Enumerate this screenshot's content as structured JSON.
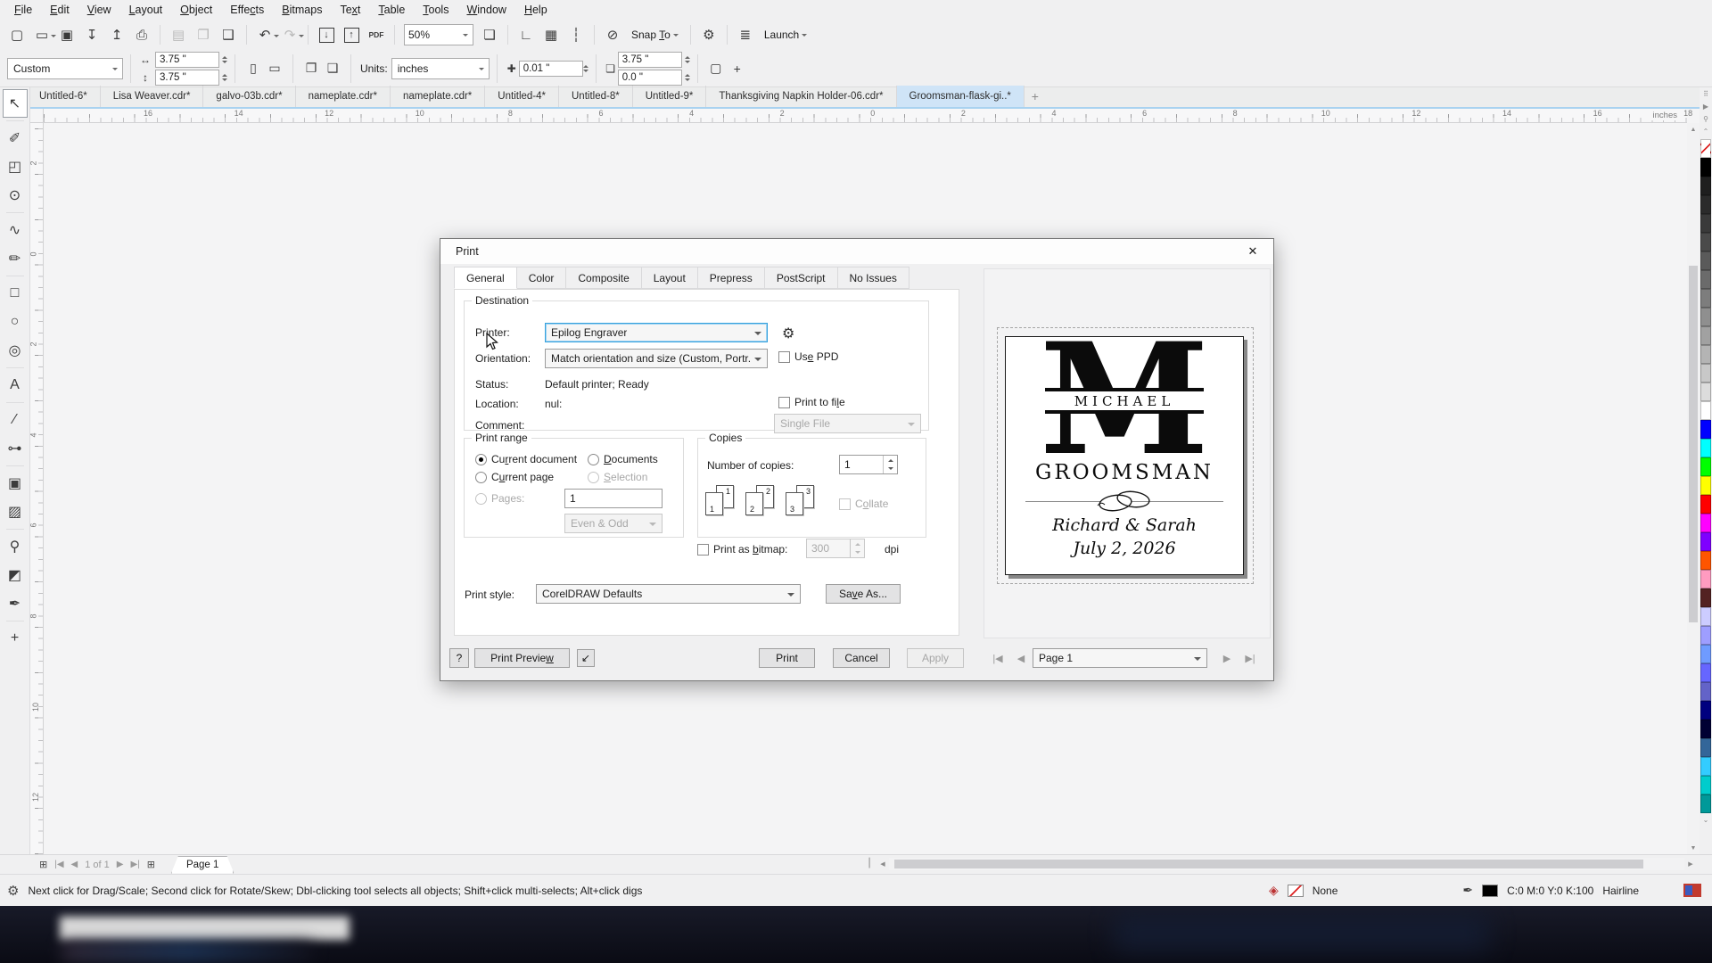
{
  "icons": {
    "close": "✕",
    "home": "⌂",
    "gear": "⚙",
    "plus": "+",
    "minimize": "↙",
    "first": "|◀",
    "prev": "◀",
    "next": "▶",
    "last": "▶|",
    "plus_page": "⊞",
    "scroll_left": "◀",
    "scroll_right": "▶",
    "scroll_up": "▲",
    "scroll_down": "▼",
    "dots": "⠿",
    "play": "▶",
    "dropper": "⚲",
    "chev_up": "⌃",
    "chev_down": "⌄",
    "fill_diamond": "◈",
    "pen_nib": "✒",
    "width_arrow": "↔",
    "height_arrow": "↕",
    "portrait": "▯",
    "landscape": "▭",
    "all_pages": "❐",
    "current_page": "❑",
    "nudge": "✚",
    "dup_distance": "❏",
    "treat_filled": "▢",
    "splitter": "┃"
  },
  "menu_bar": {
    "items": [
      {
        "label": "File",
        "key": 0
      },
      {
        "label": "Edit",
        "key": 0
      },
      {
        "label": "View",
        "key": 0
      },
      {
        "label": "Layout",
        "key": 0
      },
      {
        "label": "Object",
        "key": 0
      },
      {
        "label": "Effects",
        "key": 4
      },
      {
        "label": "Bitmaps",
        "key": 0
      },
      {
        "label": "Text",
        "key": 2
      },
      {
        "label": "Table",
        "key": 0
      },
      {
        "label": "Tools",
        "key": 0
      },
      {
        "label": "Window",
        "key": 0
      },
      {
        "label": "Help",
        "key": 0
      }
    ]
  },
  "toolbar": {
    "zoom_level": "50%",
    "snap_to_label": "Snap To",
    "snap_key": 5,
    "launch_label": "Launch",
    "items": [
      {
        "name": "new-document-icon",
        "glyph": "▢"
      },
      {
        "name": "open-icon",
        "glyph": "▭",
        "dropdown": true
      },
      {
        "name": "save-icon",
        "glyph": "▣"
      },
      {
        "name": "import-cloud-icon",
        "glyph": "↧"
      },
      {
        "name": "export-cloud-icon",
        "glyph": "↥"
      },
      {
        "name": "print-icon",
        "glyph": "⎙"
      },
      {
        "type": "sep"
      },
      {
        "name": "paste-icon",
        "glyph": "▤",
        "disabled": true
      },
      {
        "name": "copy-icon",
        "glyph": "❐",
        "disabled": true
      },
      {
        "name": "duplicate-icon",
        "glyph": "❑"
      },
      {
        "type": "sep"
      },
      {
        "name": "undo-icon",
        "glyph": "↶",
        "dropdown": true
      },
      {
        "name": "redo-icon",
        "glyph": "↷",
        "disabled": true,
        "dropdown": true
      },
      {
        "type": "sep"
      },
      {
        "name": "import-icon",
        "glyph": "↓",
        "boxed": true
      },
      {
        "name": "export-icon",
        "glyph": "↑",
        "boxed": true
      },
      {
        "name": "pdf-icon",
        "glyph": "PDF",
        "small": true
      },
      {
        "type": "sep"
      },
      {
        "type": "zoom",
        "name": "zoom-level-combo"
      },
      {
        "name": "fullscreen-icon",
        "glyph": "❏"
      },
      {
        "type": "sep"
      },
      {
        "name": "rulers-icon",
        "glyph": "∟"
      },
      {
        "name": "grid-icon",
        "glyph": "▦"
      },
      {
        "name": "guidelines-icon",
        "glyph": "┆"
      },
      {
        "type": "sep"
      },
      {
        "name": "snap-disable-icon",
        "glyph": "⊘"
      },
      {
        "type": "snap",
        "name": "snap-to-dropdown"
      },
      {
        "type": "sep"
      },
      {
        "name": "options-gear-icon",
        "glyph": "⚙"
      },
      {
        "type": "sep"
      },
      {
        "name": "launch-icon",
        "glyph": "≣"
      },
      {
        "type": "launch",
        "name": "launch-dropdown"
      }
    ]
  },
  "property_bar": {
    "preset": "Custom",
    "page_width": "3.75 \"",
    "page_height": "3.75 \"",
    "units_label": "Units:",
    "units": "inches",
    "nudge": "0.01 \"",
    "dup_x": "3.75 \"",
    "dup_y": "0.0 \""
  },
  "document_tabs": {
    "tabs": [
      {
        "label": "Untitled-6*"
      },
      {
        "label": "Lisa Weaver.cdr*"
      },
      {
        "label": "galvo-03b.cdr*"
      },
      {
        "label": "nameplate.cdr*"
      },
      {
        "label": "nameplate.cdr*"
      },
      {
        "label": "Untitled-4*"
      },
      {
        "label": "Untitled-8*"
      },
      {
        "label": "Untitled-9*"
      },
      {
        "label": "Thanksgiving Napkin Holder-06.cdr*"
      },
      {
        "label": "Groomsman-flask-gi..*",
        "active": true
      }
    ]
  },
  "ruler": {
    "unit_label": "inches",
    "h_numbers": [
      "16",
      "14",
      "12",
      "10",
      "8",
      "6",
      "4",
      "2",
      "0",
      "2",
      "4",
      "6",
      "8",
      "10",
      "12",
      "14",
      "16",
      "18"
    ],
    "v_numbers": [
      "2",
      "0",
      "2",
      "4",
      "6",
      "8",
      "10",
      "12"
    ]
  },
  "toolbox": {
    "tools": [
      {
        "name": "pick-tool",
        "glyph": "↖",
        "selected": true
      },
      {
        "type": "sep"
      },
      {
        "name": "shape-tool",
        "glyph": "✐"
      },
      {
        "name": "crop-tool",
        "glyph": "◰"
      },
      {
        "name": "zoom-tool",
        "glyph": "⊙"
      },
      {
        "type": "sep"
      },
      {
        "name": "freehand-tool",
        "glyph": "∿"
      },
      {
        "name": "artistic-media-tool",
        "glyph": "✏"
      },
      {
        "type": "sep"
      },
      {
        "name": "rectangle-tool",
        "glyph": "□"
      },
      {
        "name": "ellipse-tool",
        "glyph": "○"
      },
      {
        "name": "polygon-tool",
        "glyph": "◎"
      },
      {
        "type": "sep"
      },
      {
        "name": "text-tool",
        "glyph": "A"
      },
      {
        "type": "sep"
      },
      {
        "name": "dimension-tool",
        "glyph": "∕"
      },
      {
        "name": "connector-tool",
        "glyph": "⊶"
      },
      {
        "type": "sep"
      },
      {
        "name": "contour-tool",
        "glyph": "▣"
      },
      {
        "name": "transparency-tool",
        "glyph": "▨"
      },
      {
        "type": "sep"
      },
      {
        "name": "eyedropper-tool",
        "glyph": "⚲"
      },
      {
        "name": "interactive-fill-tool",
        "glyph": "◩"
      },
      {
        "name": "outline-pen-tool",
        "glyph": "✒"
      },
      {
        "type": "sep"
      },
      {
        "name": "more-tools",
        "glyph": "+"
      }
    ]
  },
  "color_palette": {
    "colors": [
      "none",
      "#000000",
      "#1f1f1f",
      "#2b2b2b",
      "#3a3a3a",
      "#4a4a4a",
      "#5a5a5a",
      "#6b6b6b",
      "#7d7d7d",
      "#8f8f8f",
      "#a1a1a1",
      "#b4b4b4",
      "#c8c8c8",
      "#dcdcdc",
      "#ffffff",
      "#0000ff",
      "#00ffff",
      "#00ff00",
      "#ffff00",
      "#ff0000",
      "#ff00ff",
      "#7f00ff",
      "#ff5500",
      "#ff9bc0",
      "#532222",
      "#ccccff",
      "#9e9eff",
      "#6f9bff",
      "#6666ff",
      "#6363c8",
      "#00007f",
      "#000033",
      "#336699",
      "#33ccff",
      "#00cccc",
      "#009999"
    ]
  },
  "print_dialog": {
    "title": "Print",
    "tabs": [
      {
        "label": "General",
        "active": true
      },
      {
        "label": "Color"
      },
      {
        "label": "Composite"
      },
      {
        "label": "Layout"
      },
      {
        "label": "Prepress"
      },
      {
        "label": "PostScript"
      },
      {
        "label": "No Issues"
      }
    ],
    "destination": {
      "legend": "Destination",
      "printer_label": "Printer:",
      "printer_value": "Epilog Engraver",
      "orientation_label": "Orientation:",
      "orientation_value": "Match orientation and size (Custom, Portr...",
      "use_ppd_label": "Use PPD",
      "status_label": "Status:",
      "status_value": "Default printer; Ready",
      "location_label": "Location:",
      "location_value": "nul:",
      "comment_label": "Comment:",
      "comment_value": "",
      "print_to_file_label": "Print to file",
      "file_mode_value": "Single File"
    },
    "print_range": {
      "legend": "Print range",
      "current_document": "Current document",
      "documents": "Documents",
      "current_page": "Current page",
      "selection": "Selection",
      "pages_label": "Pages:",
      "pages_value": "1",
      "even_odd_value": "Even & Odd"
    },
    "copies": {
      "legend": "Copies",
      "label": "Number of copies:",
      "value": "1",
      "collate_label": "Collate",
      "collate_pages": [
        "1",
        "2",
        "3"
      ]
    },
    "bitmap": {
      "label": "Print as bitmap:",
      "dpi_value": "300",
      "dpi_unit": "dpi"
    },
    "style": {
      "label": "Print style:",
      "value": "CorelDRAW Defaults",
      "save_as": "Save As..."
    },
    "footer": {
      "help": "?",
      "print_preview": "Print Preview",
      "print": "Print",
      "cancel": "Cancel",
      "apply": "Apply"
    },
    "preview": {
      "page_selector": "Page 1",
      "design": {
        "monogram": "M",
        "first_name": "MICHAEL",
        "role": "GROOMSMAN",
        "couple": "Richard & Sarah",
        "date": "July 2, 2026"
      }
    }
  },
  "page_navigator": {
    "count": "1 of 1",
    "tab": "Page 1"
  },
  "status_bar": {
    "hint": "Next click for Drag/Scale; Second click for Rotate/Skew; Dbl-clicking tool selects all objects; Shift+click multi-selects; Alt+click digs",
    "fill_label": "None",
    "outline_color": "C:0 M:0 Y:0 K:100",
    "outline_width": "Hairline"
  },
  "theme": {
    "accent_blue": "#36a1dd",
    "active_tab": "#cfe4f7",
    "taskbar_bg": "#10121e"
  }
}
